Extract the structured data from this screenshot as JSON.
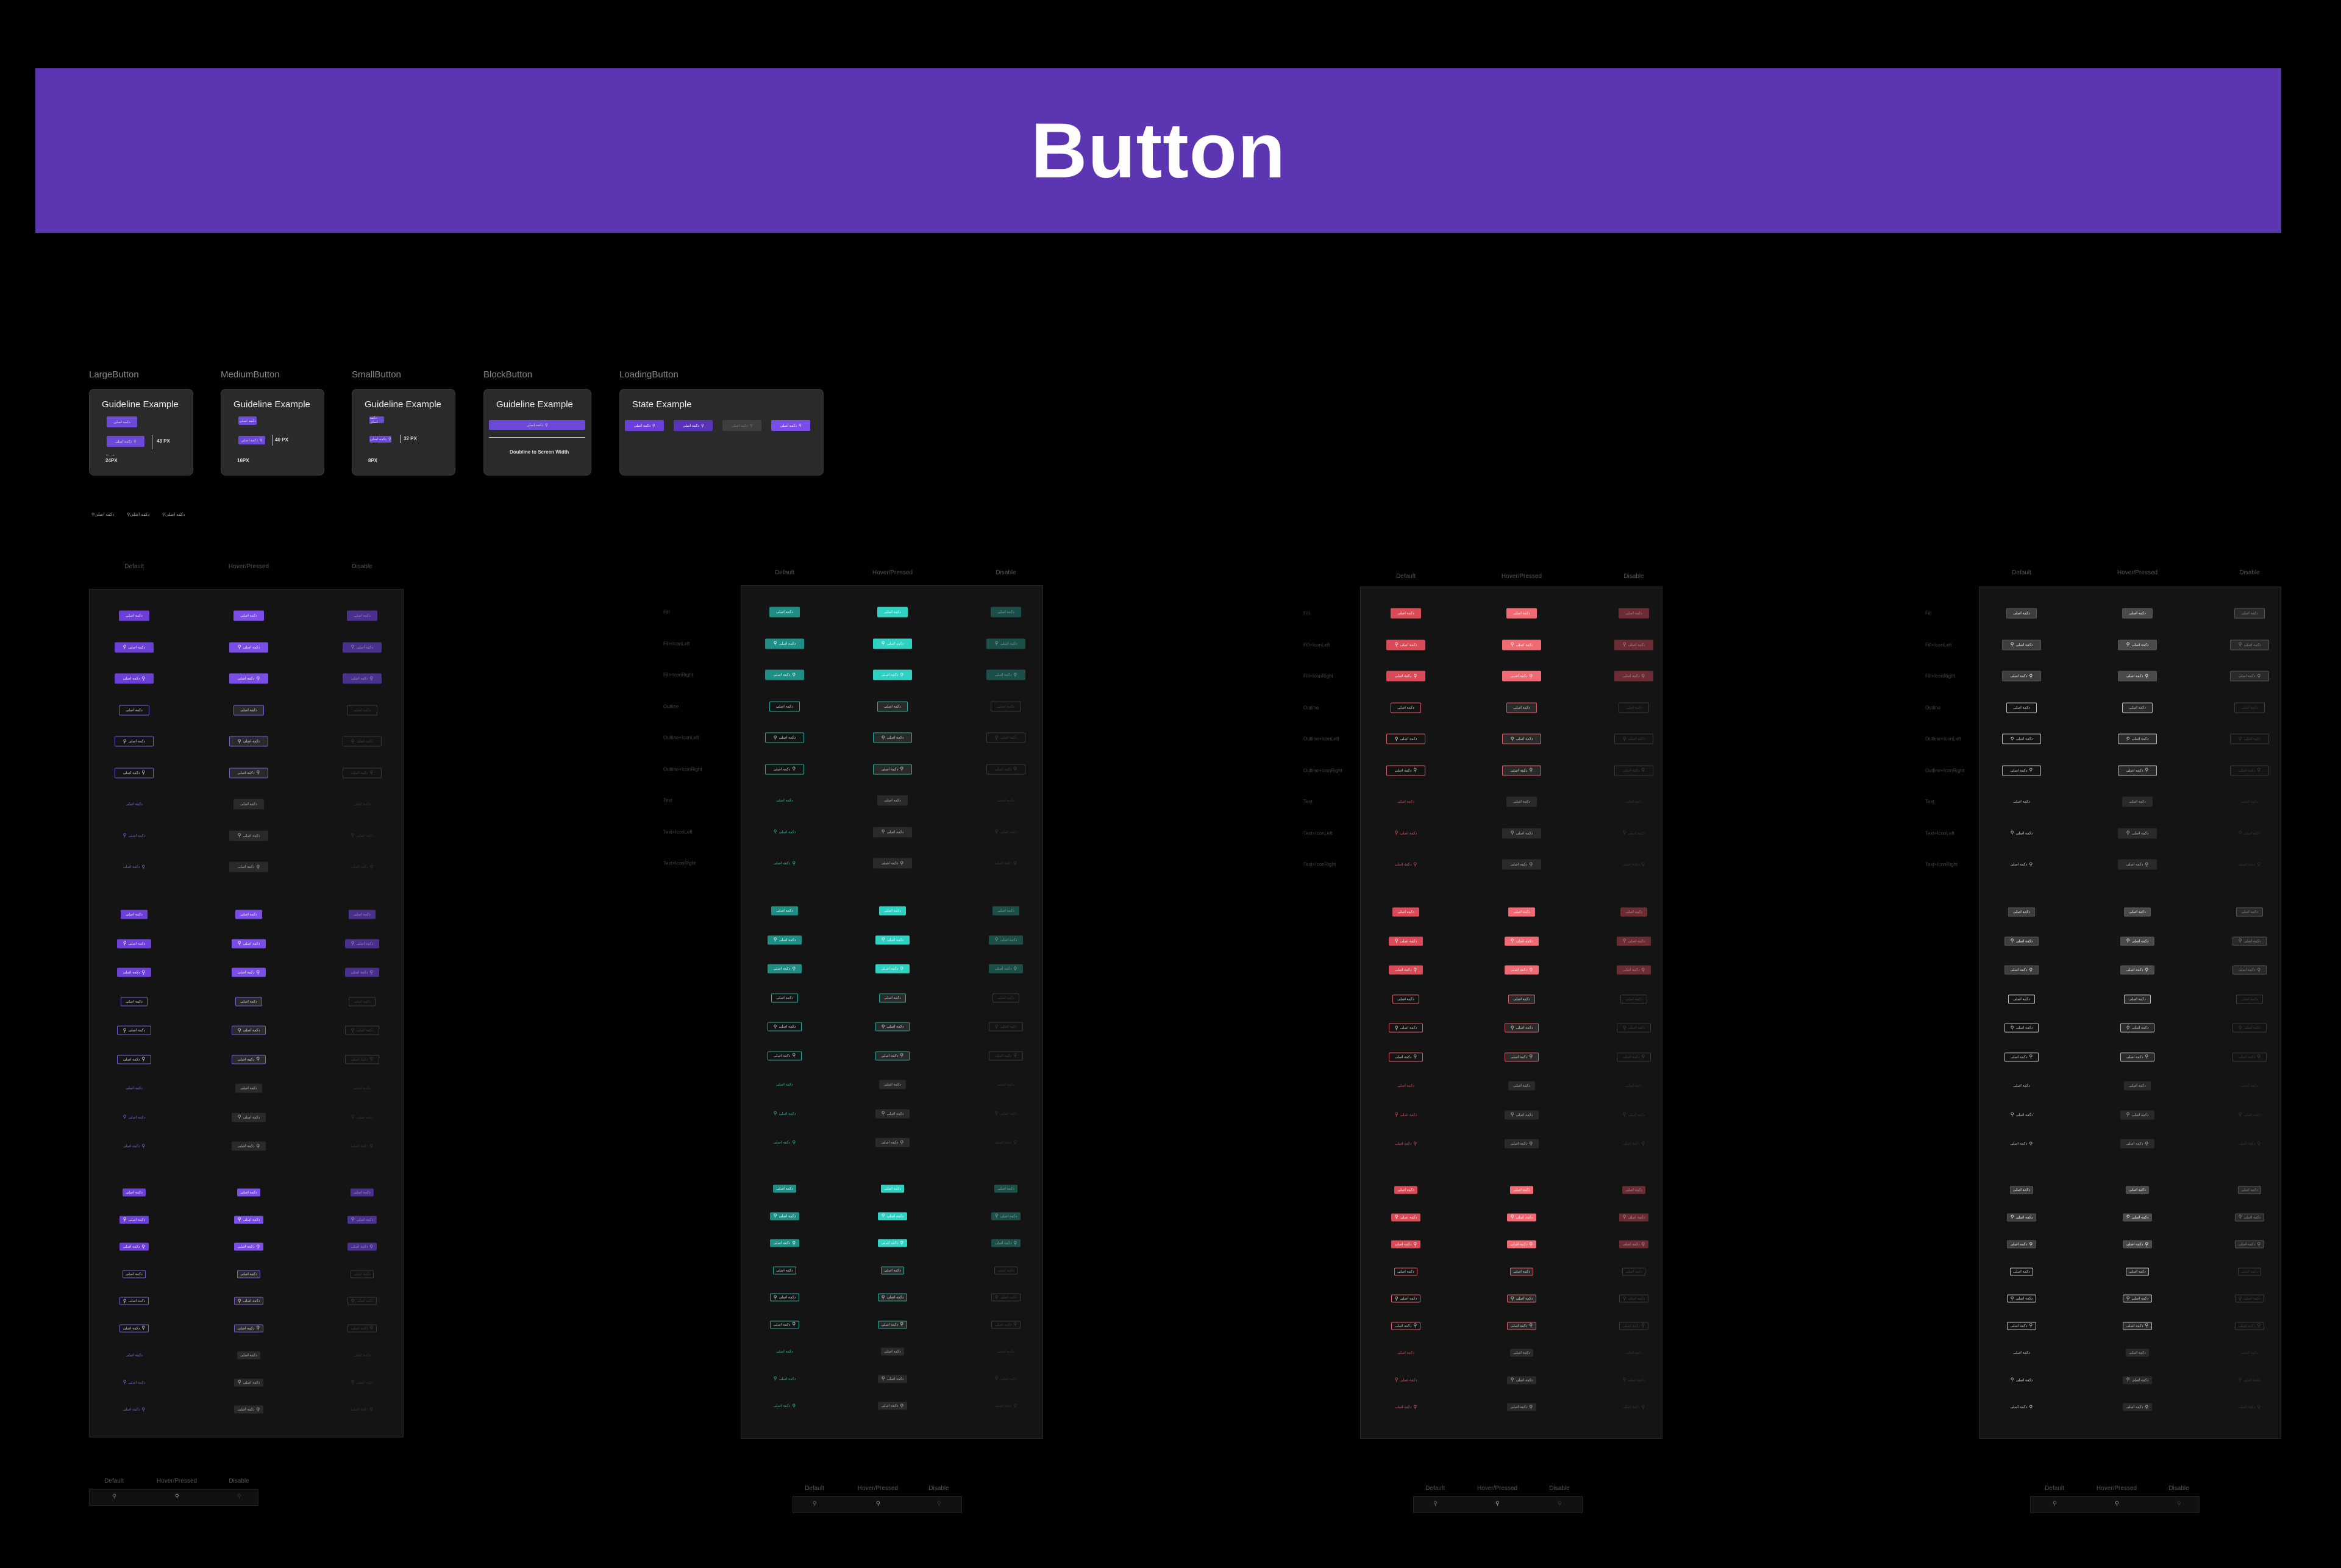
{
  "page": {
    "title": "Button"
  },
  "colors": {
    "purple": "#6c3fd8",
    "purple_hover": "#7a4de6",
    "purple_disabled": "#4a2f8c",
    "teal": "#1f8f86",
    "teal_hover": "#2fd1c2",
    "teal_disabled": "#1d4f4a",
    "red": "#d94b57",
    "red_hover": "#f06a74",
    "red_disabled": "#6b2d33",
    "gray": "#3e3e3e",
    "gray_hover": "#4a4a4a",
    "gray_disabled": "#2a2a2a"
  },
  "cards": [
    {
      "label": "LargeButton",
      "title": "Guideline Example",
      "notes": [
        "48 PX",
        "24PX",
        "←→"
      ]
    },
    {
      "label": "MediumButton",
      "title": "Guideline Example",
      "notes": [
        "40 PX",
        "16PX"
      ]
    },
    {
      "label": "SmallButton",
      "title": "Guideline Example",
      "notes": [
        "32 PX",
        "8PX"
      ]
    },
    {
      "label": "BlockButton",
      "title": "Guideline Example",
      "notes": [
        "Doubline to Screen Width"
      ]
    },
    {
      "label": "LoadingButton",
      "title": "State Example",
      "notes": []
    }
  ],
  "button_text": "دکمه اصلی",
  "search_icon": "search-icon",
  "samples": [
    "دکمه اصلی",
    "دکمه اصلی",
    "دکمه اصلی"
  ],
  "columns": {
    "default": "Default",
    "hover": "Hover/Pressed",
    "disable": "Disable"
  },
  "row_labels": [
    "Fill",
    "Fill+IconLeft",
    "Fill+IconRight",
    "Outline",
    "Outline+IconLeft",
    "Outline+IconRight",
    "Text",
    "Text+IconLeft",
    "Text+IconRight"
  ]
}
